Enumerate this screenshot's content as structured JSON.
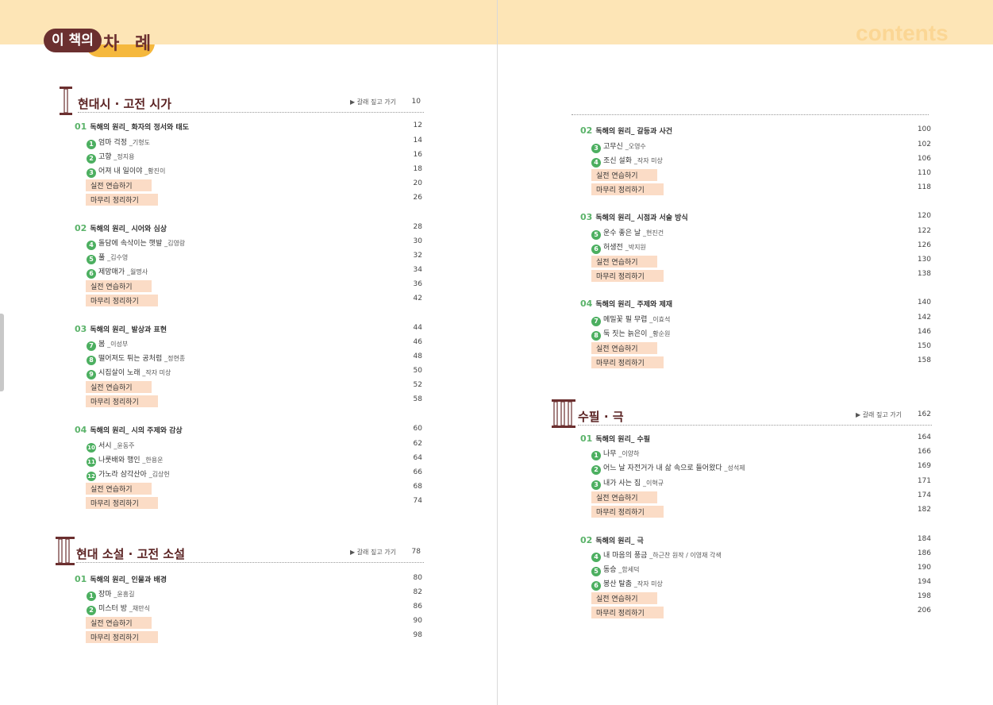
{
  "header": {
    "logo_part1": "이 책의",
    "logo_part2": "차 례",
    "contents_word": "contents"
  },
  "chapters": {
    "c1": {
      "numeral": "I",
      "title": "현대시 · 고전 시가",
      "link": "▶ 갈래 짚고 가기",
      "page": "10"
    },
    "c2": {
      "numeral": "II",
      "title": "현대 소설 · 고전 소설",
      "link": "▶ 갈래 짚고 가기",
      "page": "78"
    },
    "c3": {
      "numeral": "III",
      "title": "수필 · 극",
      "link": "▶ 갈래 짚고 가기",
      "page": "162"
    }
  },
  "rows": [
    {
      "type": "section",
      "num": "01",
      "title": "독해의 원리_ 화자의 정서와 태도",
      "page": "12"
    },
    {
      "type": "item",
      "badge": "1",
      "title": "엄마 걱정",
      "author": "_기형도",
      "page": "14"
    },
    {
      "type": "item",
      "badge": "2",
      "title": "고향",
      "author": "_정지용",
      "page": "16"
    },
    {
      "type": "item",
      "badge": "3",
      "title": "어져 내 일이야",
      "author": "_황진이",
      "page": "18"
    },
    {
      "type": "practice",
      "title": "실전 연습하기",
      "page": "20"
    },
    {
      "type": "practice",
      "title": "마무리 정리하기",
      "page": "26"
    },
    {
      "type": "section",
      "num": "02",
      "title": "독해의 원리_ 시어와 심상",
      "page": "28"
    },
    {
      "type": "item",
      "badge": "4",
      "title": "돌담에 속삭이는 햇발",
      "author": "_김영랑",
      "page": "30"
    },
    {
      "type": "item",
      "badge": "5",
      "title": "풀",
      "author": "_김수영",
      "page": "32"
    },
    {
      "type": "item",
      "badge": "6",
      "title": "제망매가",
      "author": "_월명사",
      "page": "34"
    },
    {
      "type": "practice",
      "title": "실전 연습하기",
      "page": "36"
    },
    {
      "type": "practice",
      "title": "마무리 정리하기",
      "page": "42"
    },
    {
      "type": "section",
      "num": "03",
      "title": "독해의 원리_ 발상과 표현",
      "page": "44"
    },
    {
      "type": "item",
      "badge": "7",
      "title": "봄",
      "author": "_이성부",
      "page": "46"
    },
    {
      "type": "item",
      "badge": "8",
      "title": "떨어져도 튀는 공처럼",
      "author": "_정현종",
      "page": "48"
    },
    {
      "type": "item",
      "badge": "9",
      "title": "시집살이 노래",
      "author": "_작자 미상",
      "page": "50"
    },
    {
      "type": "practice",
      "title": "실전 연습하기",
      "page": "52"
    },
    {
      "type": "practice",
      "title": "마무리 정리하기",
      "page": "58"
    },
    {
      "type": "section",
      "num": "04",
      "title": "독해의 원리_ 시의 주제와 감상",
      "page": "60"
    },
    {
      "type": "item",
      "badge": "10",
      "title": "서시",
      "author": "_윤동주",
      "page": "62"
    },
    {
      "type": "item",
      "badge": "11",
      "title": "나룻배와 행인",
      "author": "_한용운",
      "page": "64"
    },
    {
      "type": "item",
      "badge": "12",
      "title": "가노라 삼각산아",
      "author": "_김상헌",
      "page": "66"
    },
    {
      "type": "practice",
      "title": "실전 연습하기",
      "page": "68"
    },
    {
      "type": "practice",
      "title": "마무리 정리하기",
      "page": "74"
    },
    {
      "type": "section",
      "num": "01",
      "title": "독해의 원리_ 인물과 배경",
      "page": "80"
    },
    {
      "type": "item",
      "badge": "1",
      "title": "장마",
      "author": "_윤흥길",
      "page": "82"
    },
    {
      "type": "item",
      "badge": "2",
      "title": "미스터 방",
      "author": "_채만식",
      "page": "86"
    },
    {
      "type": "practice",
      "title": "실전 연습하기",
      "page": "90"
    },
    {
      "type": "practice",
      "title": "마무리 정리하기",
      "page": "98"
    },
    {
      "type": "section",
      "num": "02",
      "title": "독해의 원리_ 갈등과 사건",
      "page": "100"
    },
    {
      "type": "item",
      "badge": "3",
      "title": "고무신",
      "author": "_오영수",
      "page": "102"
    },
    {
      "type": "item",
      "badge": "4",
      "title": "조신 설화",
      "author": "_작자 미상",
      "page": "106"
    },
    {
      "type": "practice",
      "title": "실전 연습하기",
      "page": "110"
    },
    {
      "type": "practice",
      "title": "마무리 정리하기",
      "page": "118"
    },
    {
      "type": "section",
      "num": "03",
      "title": "독해의 원리_ 시점과 서술 방식",
      "page": "120"
    },
    {
      "type": "item",
      "badge": "5",
      "title": "운수 좋은 날",
      "author": "_현진건",
      "page": "122"
    },
    {
      "type": "item",
      "badge": "6",
      "title": "허생전",
      "author": "_박지원",
      "page": "126"
    },
    {
      "type": "practice",
      "title": "실전 연습하기",
      "page": "130"
    },
    {
      "type": "practice",
      "title": "마무리 정리하기",
      "page": "138"
    },
    {
      "type": "section",
      "num": "04",
      "title": "독해의 원리_ 주제와 제재",
      "page": "140"
    },
    {
      "type": "item",
      "badge": "7",
      "title": "메밀꽃 필 무렵",
      "author": "_이효석",
      "page": "142"
    },
    {
      "type": "item",
      "badge": "8",
      "title": "둑 짓는 늙은이",
      "author": "_황순원",
      "page": "146"
    },
    {
      "type": "practice",
      "title": "실전 연습하기",
      "page": "150"
    },
    {
      "type": "practice",
      "title": "마무리 정리하기",
      "page": "158"
    },
    {
      "type": "section",
      "num": "01",
      "title": "독해의 원리_ 수필",
      "page": "164"
    },
    {
      "type": "item",
      "badge": "1",
      "title": "나무",
      "author": "_이양하",
      "page": "166"
    },
    {
      "type": "item",
      "badge": "2",
      "title": "어느 날 자전거가 내 삶 속으로 들어왔다",
      "author": "_성석제",
      "page": "169"
    },
    {
      "type": "item",
      "badge": "3",
      "title": "내가 사는 집",
      "author": "_이혁규",
      "page": "171"
    },
    {
      "type": "practice",
      "title": "실전 연습하기",
      "page": "174"
    },
    {
      "type": "practice",
      "title": "마무리 정리하기",
      "page": "182"
    },
    {
      "type": "section",
      "num": "02",
      "title": "독해의 원리_ 극",
      "page": "184"
    },
    {
      "type": "item",
      "badge": "4",
      "title": "내 마음의 풍금",
      "author": "_하근찬 원작 / 이영재 각색",
      "page": "186"
    },
    {
      "type": "item",
      "badge": "5",
      "title": "동승",
      "author": "_함세덕",
      "page": "190"
    },
    {
      "type": "item",
      "badge": "6",
      "title": "봉산 탈춤",
      "author": "_작자 미상",
      "page": "194"
    },
    {
      "type": "practice",
      "title": "실전 연습하기",
      "page": "198"
    },
    {
      "type": "practice",
      "title": "마무리 정리하기",
      "page": "206"
    }
  ]
}
